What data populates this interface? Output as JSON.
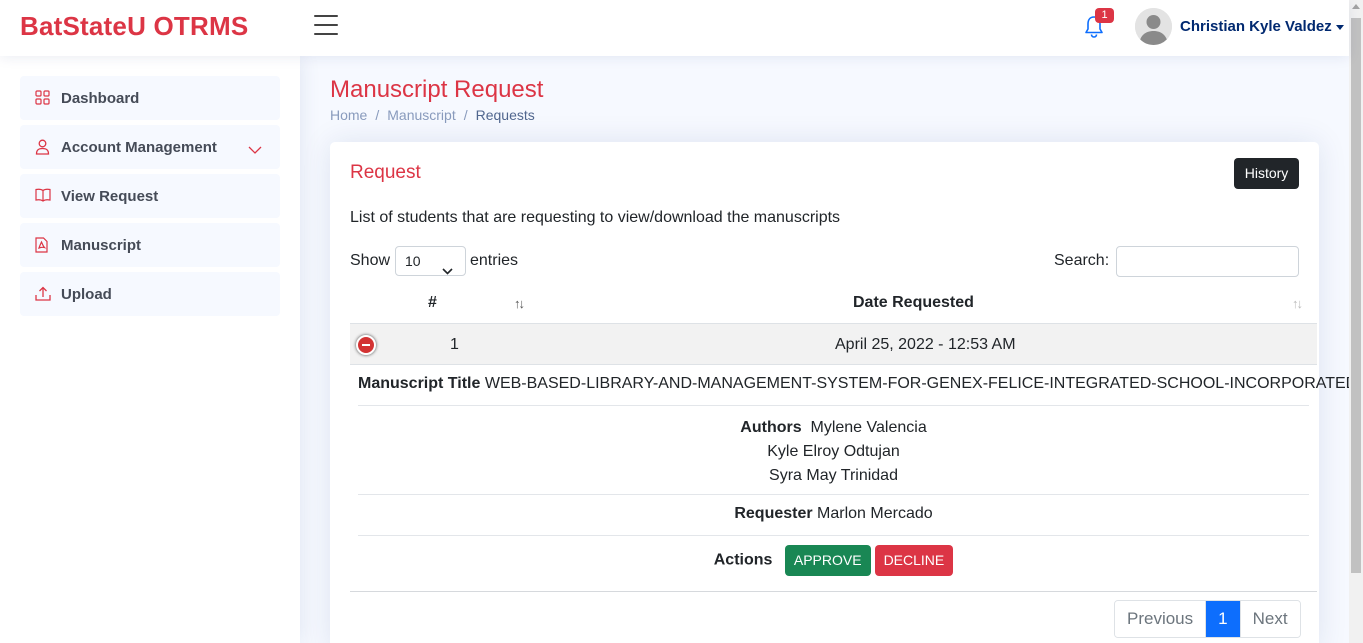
{
  "app": {
    "logo": "BatStateU OTRMS"
  },
  "header": {
    "notification_count": "1",
    "user_name": "Christian Kyle Valdez"
  },
  "sidebar": {
    "items": [
      {
        "label": "Dashboard",
        "icon": "grid-icon"
      },
      {
        "label": "Account Management",
        "icon": "person-icon"
      },
      {
        "label": "View Request",
        "icon": "book-icon"
      },
      {
        "label": "Manuscript",
        "icon": "pdf-file-icon"
      },
      {
        "label": "Upload",
        "icon": "upload-icon"
      }
    ]
  },
  "page": {
    "title": "Manuscript Request",
    "breadcrumb": [
      "Home",
      "Manuscript",
      "Requests"
    ]
  },
  "card": {
    "title": "Request",
    "history_label": "History",
    "description": "List of students that are requesting to view/download the manuscripts",
    "show_label": "Show",
    "entries_value": "10",
    "entries_label": "entries",
    "search_label": "Search:",
    "search_value": ""
  },
  "table": {
    "columns": [
      "#",
      "Date Requested"
    ],
    "rows": [
      {
        "num": "1",
        "date": "April 25, 2022 - 12:53 AM"
      }
    ],
    "detail": {
      "title_label": "Manuscript Title",
      "title_value": "WEB-BASED-LIBRARY-AND-MANAGEMENT-SYSTEM-FOR-GENEX-FELICE-INTEGRATED-SCHOOL-INCORPORATED",
      "authors_label": "Authors",
      "authors": [
        "Mylene Valencia",
        "Kyle Elroy Odtujan",
        "Syra May Trinidad"
      ],
      "requester_label": "Requester",
      "requester_value": "Marlon Mercado",
      "actions_label": "Actions",
      "approve_label": "APPROVE",
      "decline_label": "DECLINE"
    }
  },
  "pagination": {
    "previous": "Previous",
    "current": "1",
    "next": "Next"
  },
  "colors": {
    "brand": "#dc3545",
    "approve": "#198754",
    "active_page": "#0d6efd"
  }
}
